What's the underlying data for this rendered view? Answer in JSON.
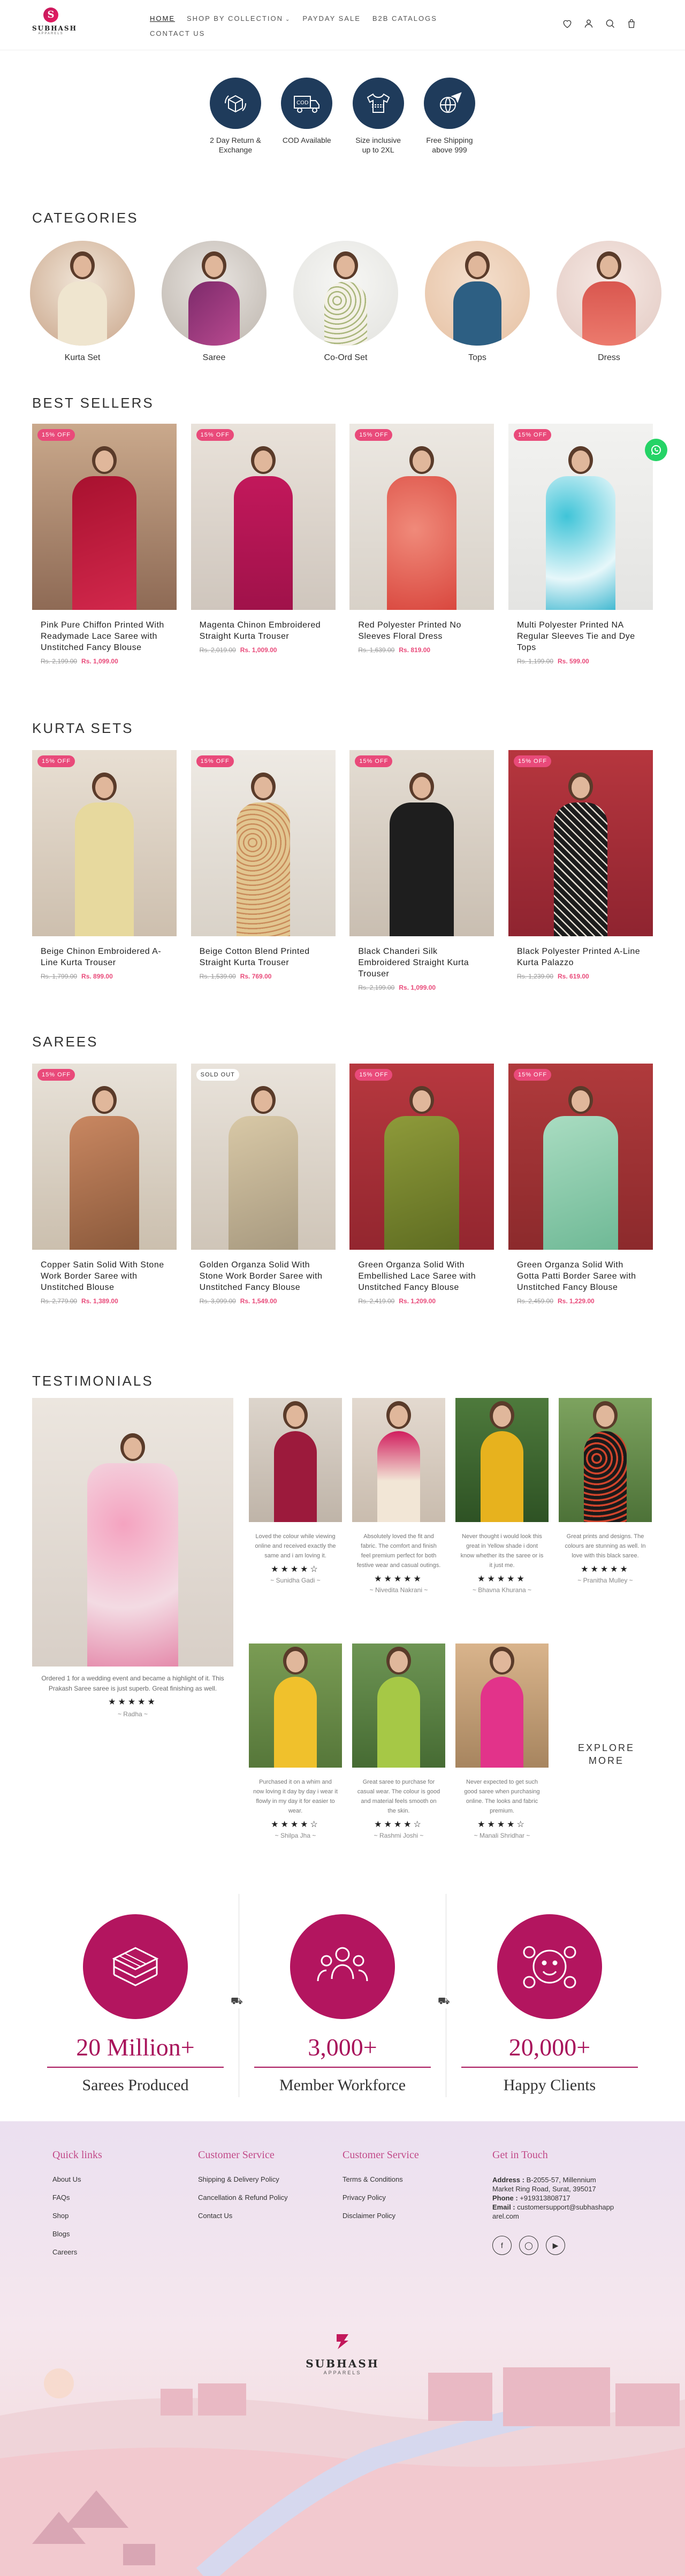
{
  "brand": {
    "name": "SUBHASH",
    "sub": "APPARELS"
  },
  "nav": {
    "row1": [
      {
        "label": "HOME"
      },
      {
        "label": "SHOP BY COLLECTION"
      },
      {
        "label": "PAYDAY SALE"
      },
      {
        "label": "B2B CATALOGS"
      }
    ],
    "row2": [
      {
        "label": "CONTACT US"
      }
    ]
  },
  "header_icons": [
    "heart-icon",
    "user-icon",
    "search-icon",
    "cart-icon"
  ],
  "features": [
    {
      "icon": "return-box-icon",
      "label": "2 Day Return & Exchange"
    },
    {
      "icon": "cod-truck-icon",
      "label": "COD Available"
    },
    {
      "icon": "tshirt-icon",
      "label": "Size inclusive up to 2XL"
    },
    {
      "icon": "globe-plane-icon",
      "label": "Free Shipping above 999"
    }
  ],
  "categories": {
    "title": "CATEGORIES",
    "items": [
      {
        "label": "Kurta Set"
      },
      {
        "label": "Saree"
      },
      {
        "label": "Co-Ord Set"
      },
      {
        "label": "Tops"
      },
      {
        "label": "Dress"
      }
    ]
  },
  "bestsellers": {
    "title": "BEST SELLERS",
    "items": [
      {
        "badge": "15% OFF",
        "title": "Pink Pure Chiffon Printed With Readymade Lace Saree with Unstitched Fancy Blouse",
        "old": "Rs. 2,199.00",
        "new": "Rs. 1,099.00"
      },
      {
        "badge": "15% OFF",
        "title": "Magenta Chinon Embroidered Straight Kurta Trouser",
        "old": "Rs. 2,019.00",
        "new": "Rs. 1,009.00"
      },
      {
        "badge": "15% OFF",
        "title": "Red Polyester Printed No Sleeves Floral Dress",
        "old": "Rs. 1,639.00",
        "new": "Rs. 819.00"
      },
      {
        "badge": "15% OFF",
        "title": "Multi Polyester Printed NA Regular Sleeves Tie and Dye Tops",
        "old": "Rs. 1,199.00",
        "new": "Rs. 599.00"
      }
    ]
  },
  "kurtasets": {
    "title": "KURTA SETS",
    "items": [
      {
        "badge": "15% OFF",
        "title": "Beige Chinon Embroidered A-Line Kurta Trouser",
        "old": "Rs. 1,799.00",
        "new": "Rs. 899.00"
      },
      {
        "badge": "15% OFF",
        "title": "Beige Cotton Blend Printed Straight Kurta Trouser",
        "old": "Rs. 1,539.00",
        "new": "Rs. 769.00"
      },
      {
        "badge": "15% OFF",
        "title": "Black Chanderi Silk Embroidered Straight Kurta Trouser",
        "old": "Rs. 2,199.00",
        "new": "Rs. 1,099.00"
      },
      {
        "badge": "15% OFF",
        "title": "Black Polyester Printed A-Line Kurta Palazzo",
        "old": "Rs. 1,239.00",
        "new": "Rs. 619.00"
      }
    ]
  },
  "sarees": {
    "title": "SAREES",
    "items": [
      {
        "badge": "15% OFF",
        "title": "Copper Satin Solid With Stone Work Border Saree with Unstitched Blouse",
        "old": "Rs. 2,779.00",
        "new": "Rs. 1,389.00"
      },
      {
        "badge": "SOLD OUT",
        "title": "Golden Organza Solid With Stone Work Border Saree with Unstitched Fancy Blouse",
        "old": "Rs. 3,099.00",
        "new": "Rs. 1,549.00"
      },
      {
        "badge": "15% OFF",
        "title": "Green Organza Solid With Embellished Lace Saree with Unstitched Fancy Blouse",
        "old": "Rs. 2,419.00",
        "new": "Rs. 1,209.00"
      },
      {
        "badge": "15% OFF",
        "title": "Green Organza Solid With Gotta Patti Border Saree with Unstitched Fancy Blouse",
        "old": "Rs. 2,459.00",
        "new": "Rs. 1,229.00"
      }
    ]
  },
  "testimonials": {
    "title": "TESTIMONIALS",
    "featured": {
      "text": "Ordered 1 for a wedding event and became a highlight of it. This Prakash Saree saree is just superb. Great finishing as well.",
      "stars": "★★★★★",
      "author": "~ Radha ~"
    },
    "items": [
      {
        "text": "Loved the colour while viewing online and received exactly the same and i am loving it.",
        "stars": "★★★★☆",
        "author": "~ Sunidha Gadi ~"
      },
      {
        "text": "Absolutely loved the fit and fabric. The comfort and finish feel premium perfect for both festive wear and casual outings.",
        "stars": "★★★★★",
        "author": "~ Nivedita Nakrani ~"
      },
      {
        "text": "Never thought i would look this great in Yellow shade i dont know whether its the saree or is it just me.",
        "stars": "★★★★★",
        "author": "~ Bhavna Khurana ~"
      },
      {
        "text": "Great prints and designs. The colours are stunning as well. In love with this black saree.",
        "stars": "★★★★★",
        "author": "~ Pranitha Mulley ~"
      },
      {
        "text": "Purchased it on a whim and now loving it day by day i wear it flowly in my day it for easier to wear.",
        "stars": "★★★★☆",
        "author": "~ Shilpa Jha ~"
      },
      {
        "text": "Great saree to purchase for casual wear. The colour is good and material feels smooth on the skin.",
        "stars": "★★★★☆",
        "author": "~ Rashmi Joshi ~"
      },
      {
        "text": "Never expected to get such good saree when purchasing online. The looks and fabric premium.",
        "stars": "★★★★☆",
        "author": "~ Manali Shridhar ~"
      }
    ],
    "explore": "EXPLORE MORE"
  },
  "stats": [
    {
      "icon": "stacked-sarees-icon",
      "number": "20 Million+",
      "caption": "Sarees Produced"
    },
    {
      "icon": "workforce-icon",
      "number": "3,000+",
      "caption": "Member Workforce"
    },
    {
      "icon": "happy-clients-icon",
      "number": "20,000+",
      "caption": "Happy Clients"
    }
  ],
  "footer": {
    "quick": {
      "title": "Quick links",
      "links": [
        "About Us",
        "FAQs",
        "Shop",
        "Blogs",
        "Careers"
      ]
    },
    "service1": {
      "title": "Customer Service",
      "links": [
        "Shipping & Delivery Policy",
        "Cancellation & Refund Policy",
        "Contact Us"
      ]
    },
    "service2": {
      "title": "Customer Service",
      "links": [
        "Terms & Conditions",
        "Privacy Policy",
        "Disclaimer Policy"
      ]
    },
    "contact": {
      "title": "Get in Touch",
      "address_label": "Address :",
      "address": "B-2055-57, Millennium Market Ring Road, Surat, 395017",
      "phone_label": "Phone :",
      "phone": "+919313808717",
      "email_label": "Email :",
      "email": "customersupport@subhashapparel.com"
    },
    "social": [
      "facebook-icon",
      "instagram-icon",
      "youtube-icon"
    ]
  },
  "colors": {
    "accent": "#e94a7a",
    "brand": "#b3155f",
    "navy": "#1f3b5b"
  }
}
